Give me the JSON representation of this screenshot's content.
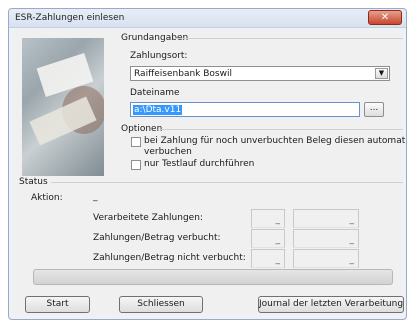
{
  "window": {
    "title": "ESR-Zahlungen einlesen",
    "close_glyph": "✕"
  },
  "grundangaben": {
    "heading": "Grundangaben",
    "zahlungsort_label": "Zahlungsort:",
    "zahlungsort_value": "Raiffeisenbank Boswil",
    "dateiname_label": "Dateiname",
    "dateiname_value": "a:\\Dta.v11",
    "browse_label": "..."
  },
  "optionen": {
    "heading": "Optionen",
    "option1_line1": "bei Zahlung für noch unverbuchten Beleg diesen automatisch",
    "option1_line2": "verbuchen",
    "option1_checked": false,
    "option2": "nur Testlauf durchführen",
    "option2_checked": false
  },
  "status": {
    "heading": "Status",
    "aktion_label": "Aktion:",
    "aktion_value": "_",
    "rows": [
      {
        "label": "Verarbeitete Zahlungen:",
        "count": "_",
        "amount": "_"
      },
      {
        "label": "Zahlungen/Betrag verbucht:",
        "count": "_",
        "amount": "_"
      },
      {
        "label": "Zahlungen/Betrag nicht verbucht:",
        "count": "_",
        "amount": "_"
      }
    ],
    "progress": 0
  },
  "buttons": {
    "start": "Start",
    "schliessen": "Schliessen",
    "journal": "Journal der letzten Verarbeitung"
  }
}
